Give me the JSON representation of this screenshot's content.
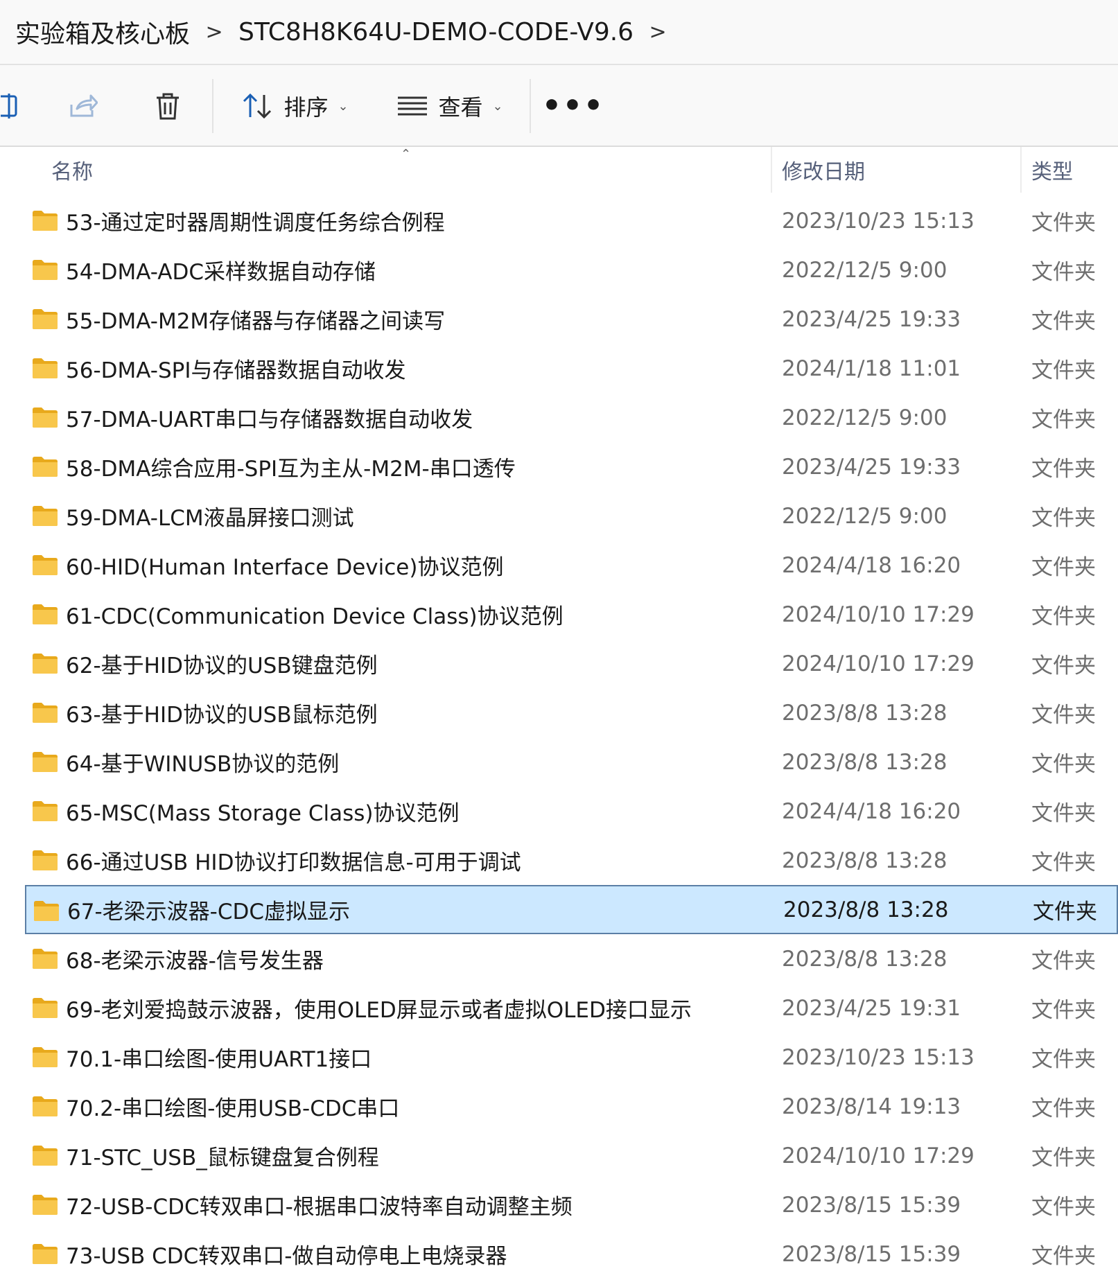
{
  "breadcrumb": {
    "items": [
      "实验箱及核心板",
      "STC8H8K64U-DEMO-CODE-V9.6"
    ],
    "separator": ">"
  },
  "toolbar": {
    "sort_label": "排序",
    "view_label": "查看",
    "more_label": "•••",
    "icons": [
      "rename-icon",
      "share-icon",
      "delete-icon",
      "sort-icon",
      "view-icon",
      "more-icon"
    ]
  },
  "columns": {
    "name": "名称",
    "date": "修改日期",
    "type": "类型"
  },
  "colors": {
    "selected_bg": "#cce8ff",
    "selected_border": "#5b7fa6",
    "folder_yellow": "#f8c74c",
    "header_text": "#56607a"
  },
  "files": [
    {
      "name": "53-通过定时器周期性调度任务综合例程",
      "date": "2023/10/23 15:13",
      "type": "文件夹",
      "selected": false
    },
    {
      "name": "54-DMA-ADC采样数据自动存储",
      "date": "2022/12/5 9:00",
      "type": "文件夹",
      "selected": false
    },
    {
      "name": "55-DMA-M2M存储器与存储器之间读写",
      "date": "2023/4/25 19:33",
      "type": "文件夹",
      "selected": false
    },
    {
      "name": "56-DMA-SPI与存储器数据自动收发",
      "date": "2024/1/18 11:01",
      "type": "文件夹",
      "selected": false
    },
    {
      "name": "57-DMA-UART串口与存储器数据自动收发",
      "date": "2022/12/5 9:00",
      "type": "文件夹",
      "selected": false
    },
    {
      "name": "58-DMA综合应用-SPI互为主从-M2M-串口透传",
      "date": "2023/4/25 19:33",
      "type": "文件夹",
      "selected": false
    },
    {
      "name": "59-DMA-LCM液晶屏接口测试",
      "date": "2022/12/5 9:00",
      "type": "文件夹",
      "selected": false
    },
    {
      "name": "60-HID(Human Interface Device)协议范例",
      "date": "2024/4/18 16:20",
      "type": "文件夹",
      "selected": false
    },
    {
      "name": "61-CDC(Communication Device Class)协议范例",
      "date": "2024/10/10 17:29",
      "type": "文件夹",
      "selected": false
    },
    {
      "name": "62-基于HID协议的USB键盘范例",
      "date": "2024/10/10 17:29",
      "type": "文件夹",
      "selected": false
    },
    {
      "name": "63-基于HID协议的USB鼠标范例",
      "date": "2023/8/8 13:28",
      "type": "文件夹",
      "selected": false
    },
    {
      "name": "64-基于WINUSB协议的范例",
      "date": "2023/8/8 13:28",
      "type": "文件夹",
      "selected": false
    },
    {
      "name": "65-MSC(Mass Storage Class)协议范例",
      "date": "2024/4/18 16:20",
      "type": "文件夹",
      "selected": false
    },
    {
      "name": "66-通过USB HID协议打印数据信息-可用于调试",
      "date": "2023/8/8 13:28",
      "type": "文件夹",
      "selected": false
    },
    {
      "name": "67-老梁示波器-CDC虚拟显示",
      "date": "2023/8/8 13:28",
      "type": "文件夹",
      "selected": true
    },
    {
      "name": "68-老梁示波器-信号发生器",
      "date": "2023/8/8 13:28",
      "type": "文件夹",
      "selected": false
    },
    {
      "name": "69-老刘爱捣鼓示波器，使用OLED屏显示或者虚拟OLED接口显示",
      "date": "2023/4/25 19:31",
      "type": "文件夹",
      "selected": false
    },
    {
      "name": "70.1-串口绘图-使用UART1接口",
      "date": "2023/10/23 15:13",
      "type": "文件夹",
      "selected": false
    },
    {
      "name": "70.2-串口绘图-使用USB-CDC串口",
      "date": "2023/8/14 19:13",
      "type": "文件夹",
      "selected": false
    },
    {
      "name": "71-STC_USB_鼠标键盘复合例程",
      "date": "2024/10/10 17:29",
      "type": "文件夹",
      "selected": false
    },
    {
      "name": "72-USB-CDC转双串口-根据串口波特率自动调整主频",
      "date": "2023/8/15 15:39",
      "type": "文件夹",
      "selected": false
    },
    {
      "name": "73-USB CDC转双串口-做自动停电上电烧录器",
      "date": "2023/8/15 15:39",
      "type": "文件夹",
      "selected": false
    }
  ]
}
